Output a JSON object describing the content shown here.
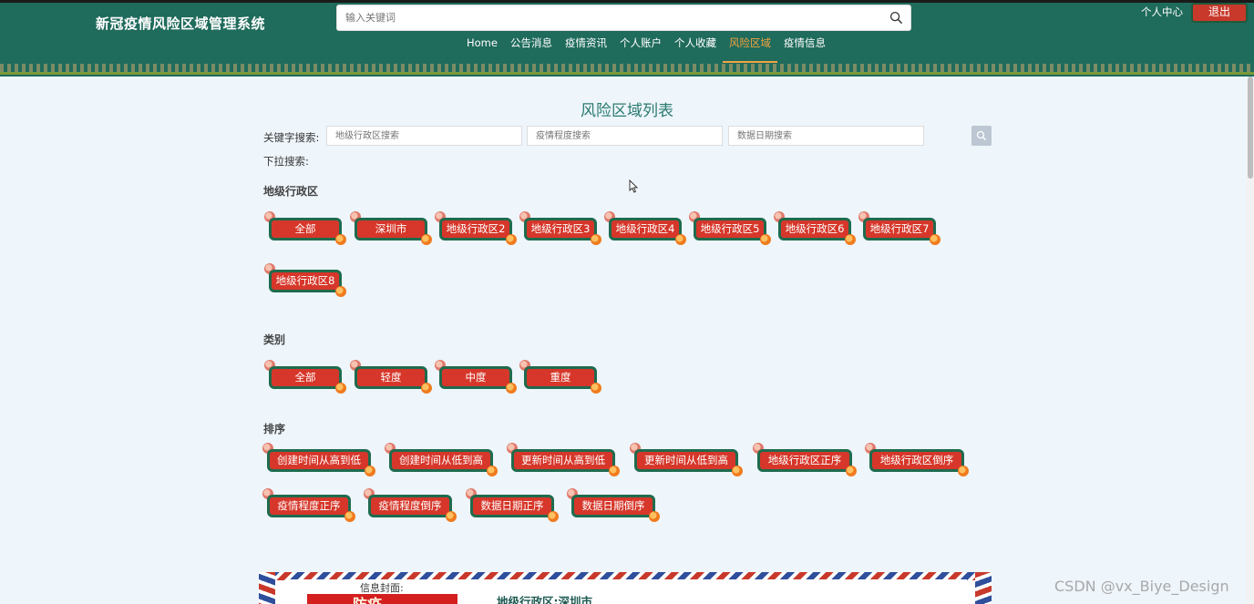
{
  "header": {
    "app_title": "新冠疫情风险区域管理系统",
    "search_placeholder": "输入关键词",
    "nav": [
      {
        "label": "Home",
        "active": false
      },
      {
        "label": "公告消息",
        "active": false
      },
      {
        "label": "疫情资讯",
        "active": false
      },
      {
        "label": "个人账户",
        "active": false
      },
      {
        "label": "个人收藏",
        "active": false
      },
      {
        "label": "风险区域",
        "active": true
      },
      {
        "label": "疫情信息",
        "active": false
      }
    ],
    "user_center": "个人中心",
    "logout": "退出"
  },
  "main": {
    "heading": "风险区域列表",
    "keyword_label": "关键字搜索:",
    "keyword_inputs": [
      "地级行政区搜索",
      "疫情程度搜索",
      "数据日期搜索"
    ],
    "dropdown_label": "下拉搜索:",
    "region_section": {
      "title": "地级行政区",
      "tags": [
        "全部",
        "深圳市",
        "地级行政区2",
        "地级行政区3",
        "地级行政区4",
        "地级行政区5",
        "地级行政区6",
        "地级行政区7",
        "地级行政区8"
      ]
    },
    "category_section": {
      "title": "类别",
      "tags": [
        "全部",
        "轻度",
        "中度",
        "重度"
      ]
    },
    "sort_section": {
      "title": "排序",
      "tags": [
        "创建时间从高到低",
        "创建时间从低到高",
        "更新时间从高到低",
        "更新时间从低到高",
        "地级行政区正序",
        "地级行政区倒序",
        "疫情程度正序",
        "疫情程度倒序",
        "数据日期正序",
        "数据日期倒序"
      ]
    },
    "card": {
      "cover_label": "信息封面:",
      "cover_text": "防疫",
      "title": "地级行政区:深圳市"
    }
  },
  "watermark": "CSDN @vx_Biye_Design",
  "colors": {
    "header_bg": "#1f6b5c",
    "accent": "#f4a340",
    "tag_bg": "#d6372a",
    "tag_border": "#1f6b4e",
    "heading": "#2a7b6f"
  }
}
